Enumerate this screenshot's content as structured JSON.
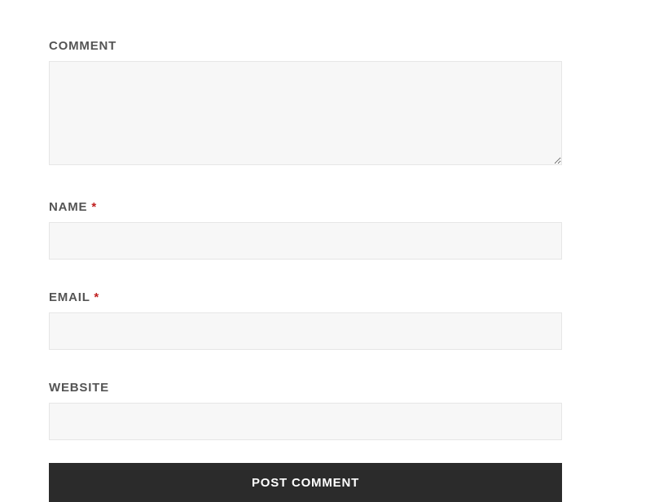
{
  "form": {
    "comment": {
      "label": "COMMENT",
      "required": false,
      "value": ""
    },
    "name": {
      "label": "NAME ",
      "required": true,
      "required_mark": "*",
      "value": ""
    },
    "email": {
      "label": "EMAIL ",
      "required": true,
      "required_mark": "*",
      "value": ""
    },
    "website": {
      "label": "WEBSITE",
      "required": false,
      "value": ""
    },
    "submit_label": "POST COMMENT"
  }
}
